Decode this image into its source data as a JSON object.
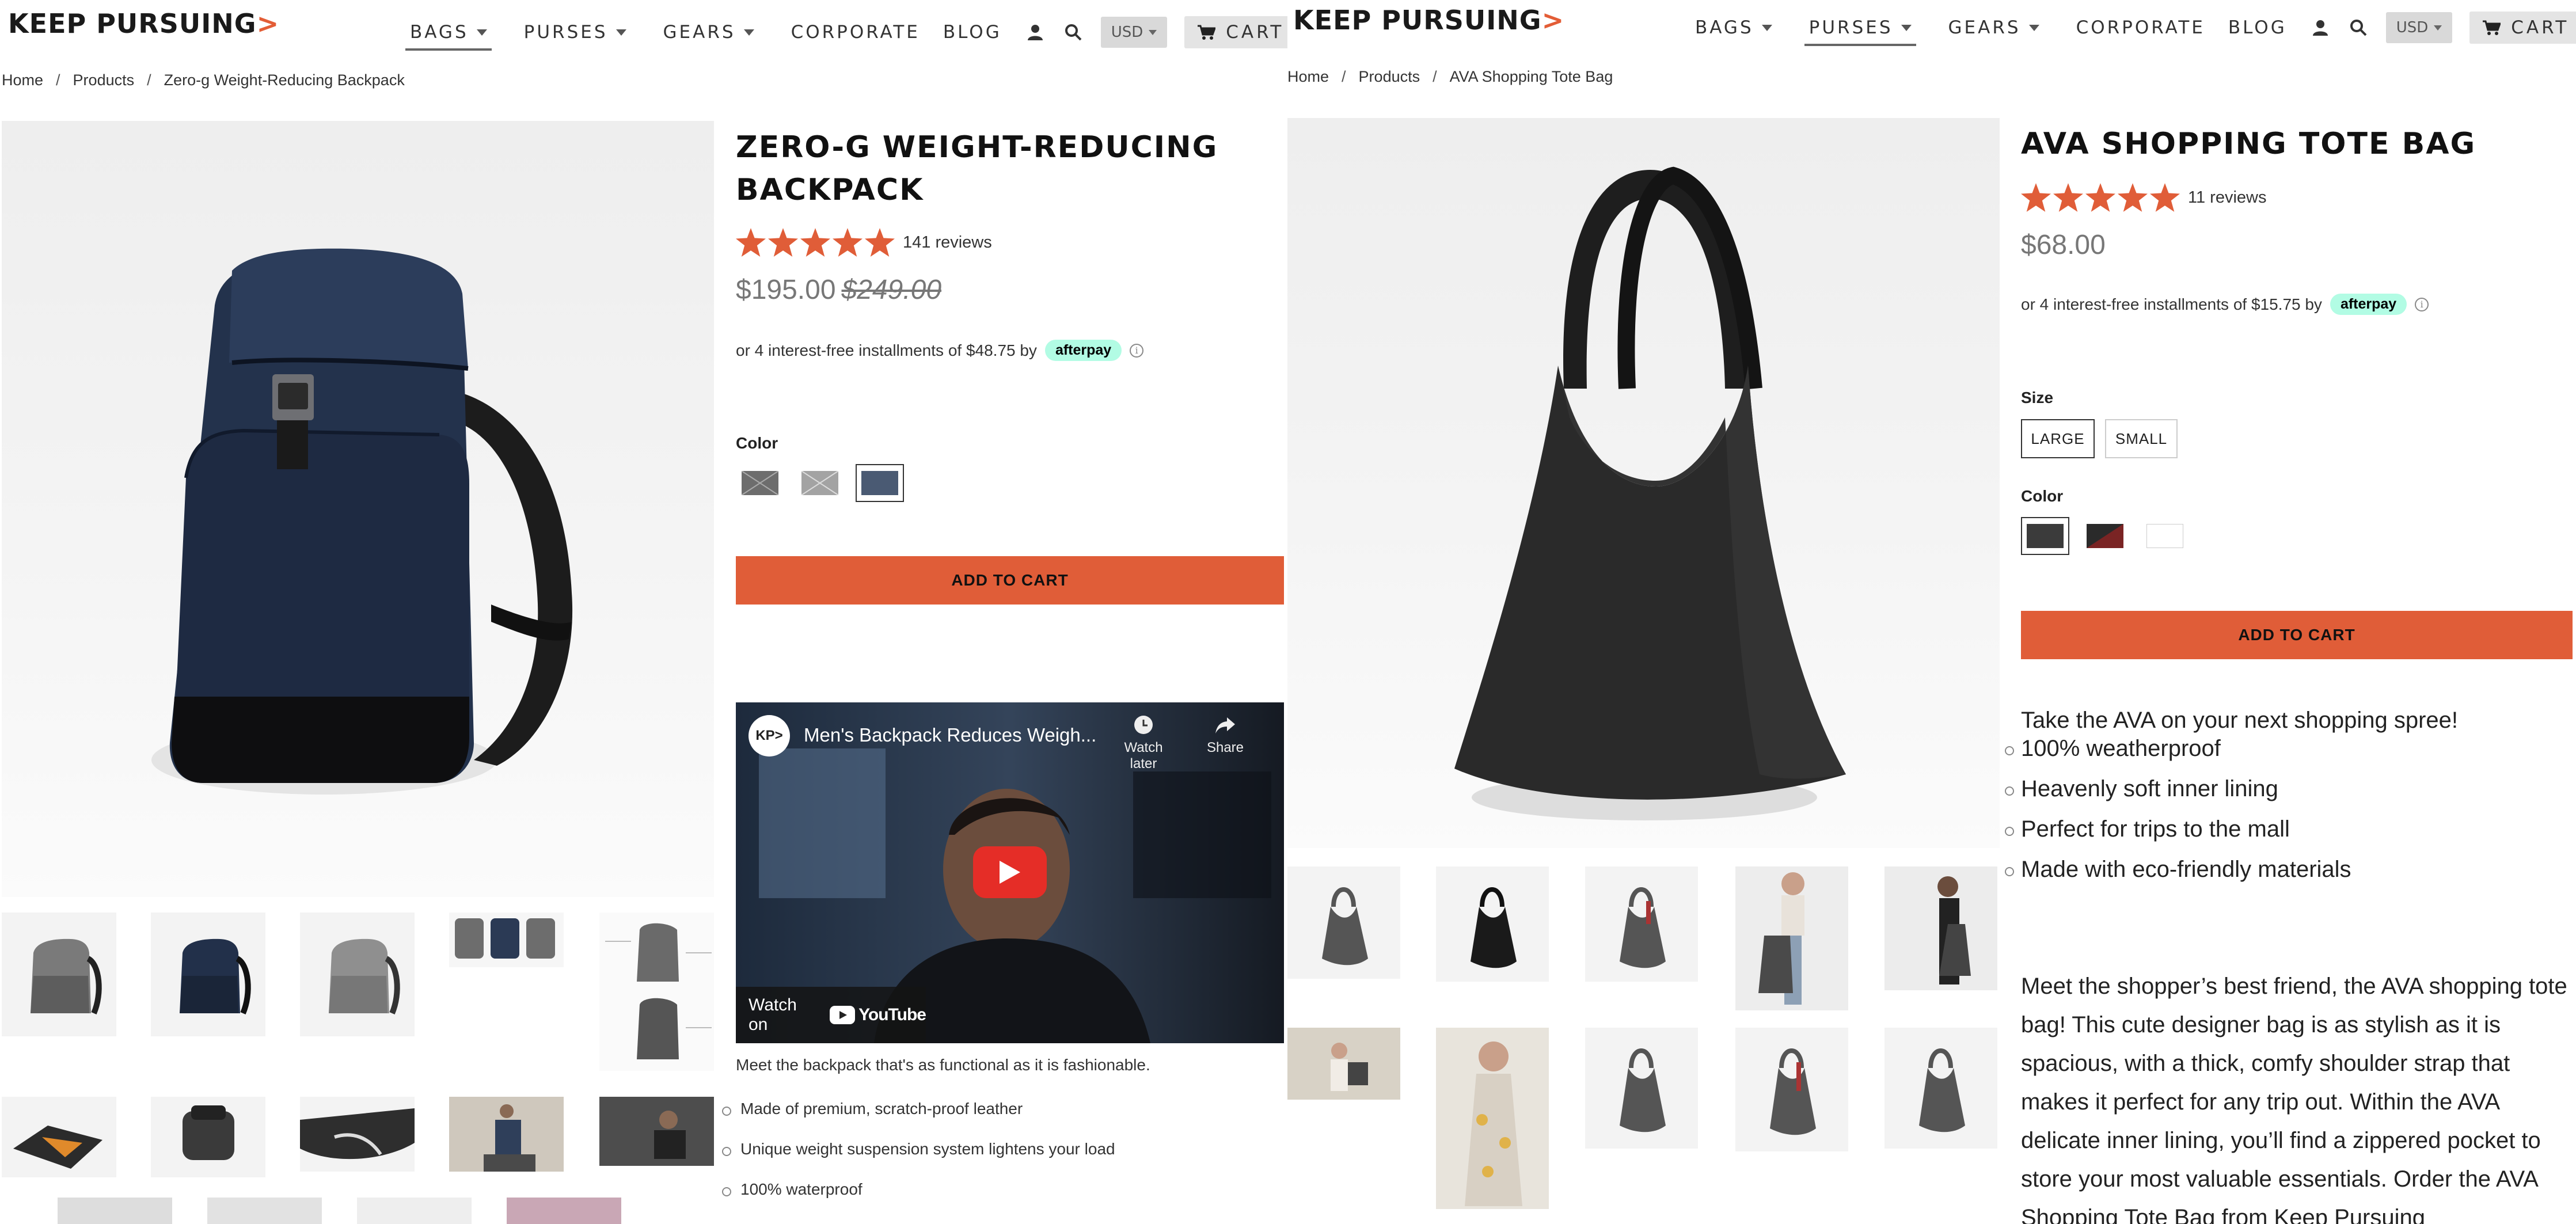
{
  "left": {
    "logo": "KEEP PURSUING",
    "nav": {
      "bags": "BAGS",
      "purses": "PURSES",
      "gears": "GEARS",
      "corporate": "CORPORATE",
      "blog": "BLOG",
      "currency": "USD",
      "cart": "CART"
    },
    "breadcrumb": {
      "home": "Home",
      "products": "Products",
      "current": "Zero-g Weight-Reducing Backpack"
    },
    "product": {
      "title": "ZERO-G WEIGHT-REDUCING BACKPACK",
      "rating": 5,
      "reviews": "141 reviews",
      "price": "$195.00",
      "compare_price": "$249.00",
      "installments": "or 4 interest-free installments of $48.75 by",
      "afterpay": "afterpay",
      "info": "i",
      "color_label": "Color",
      "colors": [
        "#6d6d6d",
        "#a3a3a3",
        "#4a5a73"
      ],
      "selected_color": 2,
      "add_to_cart": "ADD TO CART"
    },
    "video": {
      "channel": "KP>",
      "title": "Men's Backpack Reduces Weigh...",
      "watch_later": "Watch later",
      "share": "Share",
      "watch_on": "Watch on",
      "youtube": "YouTube"
    },
    "description": "Meet the backpack that's as functional as it is fashionable.",
    "bullets": [
      "Made of premium, scratch-proof leather",
      "Unique weight suspension system lightens your load",
      "100% waterproof"
    ]
  },
  "right": {
    "logo": "KEEP PURSUING",
    "nav": {
      "bags": "BAGS",
      "purses": "PURSES",
      "gears": "GEARS",
      "corporate": "CORPORATE",
      "blog": "BLOG",
      "currency": "USD",
      "cart": "CART"
    },
    "breadcrumb": {
      "home": "Home",
      "products": "Products",
      "current": "AVA Shopping Tote Bag"
    },
    "product": {
      "title": "AVA SHOPPING TOTE BAG",
      "rating": 5,
      "reviews": "11 reviews",
      "price": "$68.00",
      "installments": "or 4 interest-free installments of $15.75 by",
      "afterpay": "afterpay",
      "info": "i",
      "size_label": "Size",
      "sizes": [
        "LARGE",
        "SMALL"
      ],
      "color_label": "Color",
      "colors": [
        "#3b3b3b",
        "#7a2424",
        "#ffffff"
      ],
      "selected_color": 0,
      "add_to_cart": "ADD TO CART"
    },
    "tagline": "Take the AVA on your next shopping spree!",
    "bullets": [
      "100% weatherproof",
      "Heavenly soft inner lining",
      "Perfect for trips to the mall",
      "Made with eco-friendly materials"
    ],
    "paragraph": "Meet the shopper’s best friend, the AVA shopping tote bag! This cute designer bag is as stylish as it is spacious, with a thick, comfy shoulder strap that makes it perfect for any trip out. Within the AVA delicate inner lining, you’ll find a zippered pocket to store your most valuable essentials. Order the AVA Shopping Tote Bag from Keep Pursuing"
  }
}
